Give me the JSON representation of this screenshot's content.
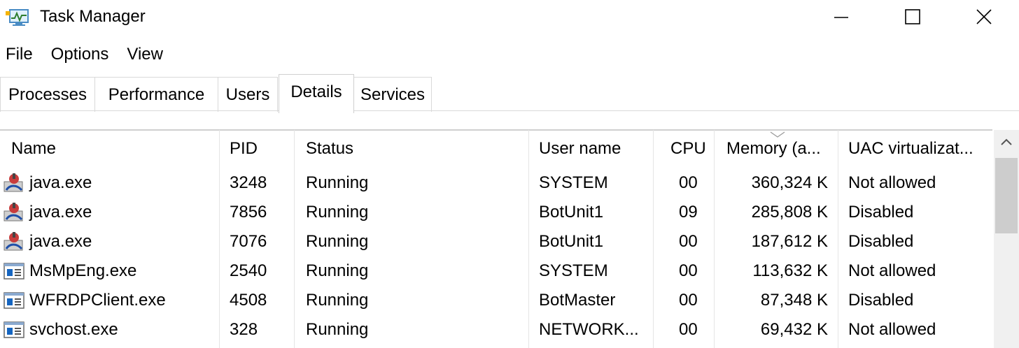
{
  "window": {
    "title": "Task Manager",
    "app_icon": "task-manager-icon"
  },
  "window_controls": {
    "minimize": "minimize-icon",
    "maximize": "maximize-icon",
    "close": "close-icon"
  },
  "menu": [
    "File",
    "Options",
    "View"
  ],
  "tabs": [
    {
      "label": "Processes",
      "active": false
    },
    {
      "label": "Performance",
      "active": false
    },
    {
      "label": "Users",
      "active": false
    },
    {
      "label": "Details",
      "active": true
    },
    {
      "label": "Services",
      "active": false
    }
  ],
  "table": {
    "columns": [
      "Name",
      "PID",
      "Status",
      "User name",
      "CPU",
      "Memory (a...",
      "UAC virtualizat..."
    ],
    "sorted_column": "Memory (a...",
    "rows": [
      {
        "icon": "java-icon",
        "name": "java.exe",
        "pid": "3248",
        "status": "Running",
        "user": "SYSTEM",
        "cpu": "00",
        "memory": "360,324 K",
        "uac": "Not allowed"
      },
      {
        "icon": "java-icon",
        "name": "java.exe",
        "pid": "7856",
        "status": "Running",
        "user": "BotUnit1",
        "cpu": "09",
        "memory": "285,808 K",
        "uac": "Disabled"
      },
      {
        "icon": "java-icon",
        "name": "java.exe",
        "pid": "7076",
        "status": "Running",
        "user": "BotUnit1",
        "cpu": "00",
        "memory": "187,612 K",
        "uac": "Disabled"
      },
      {
        "icon": "app-window-icon",
        "name": "MsMpEng.exe",
        "pid": "2540",
        "status": "Running",
        "user": "SYSTEM",
        "cpu": "00",
        "memory": "113,632 K",
        "uac": "Not allowed"
      },
      {
        "icon": "app-window-icon",
        "name": "WFRDPClient.exe",
        "pid": "4508",
        "status": "Running",
        "user": "BotMaster",
        "cpu": "00",
        "memory": "87,348 K",
        "uac": "Disabled"
      },
      {
        "icon": "app-window-icon",
        "name": "svchost.exe",
        "pid": "328",
        "status": "Running",
        "user": "NETWORK...",
        "cpu": "00",
        "memory": "69,432 K",
        "uac": "Not allowed"
      }
    ]
  },
  "colors": {
    "accent": "#0078d7",
    "separator": "#e5e5e5"
  }
}
